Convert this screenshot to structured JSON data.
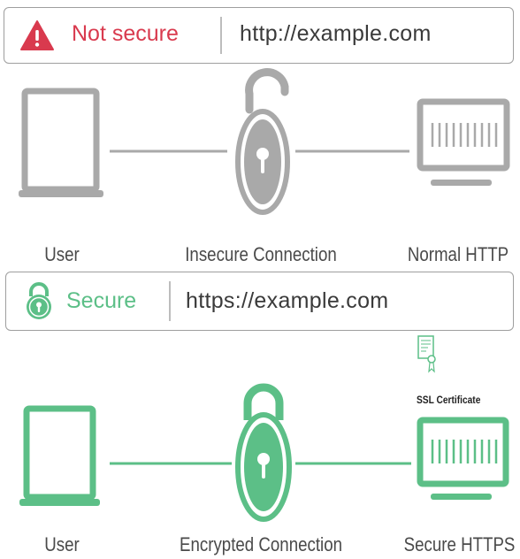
{
  "top_bar": {
    "status_text": "Not secure",
    "url": "http://example.com"
  },
  "insecure_row": {
    "labels": [
      "User",
      "Insecure Connection",
      "Normal HTTP"
    ]
  },
  "bottom_bar": {
    "status_text": "Secure",
    "url": "https://example.com"
  },
  "secure_row": {
    "certificate_label": "SSL Certificate",
    "labels": [
      "User",
      "Encrypted Connection",
      "Secure HTTPS"
    ]
  },
  "colors": {
    "insecure_red": "#d93a4e",
    "secure_green": "#5cbf87",
    "neutral_gray": "#a9a9a9"
  },
  "icons": [
    "warning-icon",
    "laptop-icon",
    "open-padlock-icon",
    "server-monitor-icon",
    "closed-padlock-icon",
    "certificate-icon"
  ]
}
